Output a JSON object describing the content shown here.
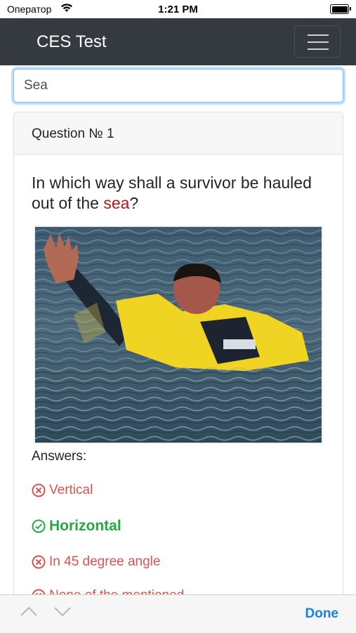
{
  "status_bar": {
    "carrier": "Оператор",
    "time": "1:21 PM"
  },
  "navbar": {
    "brand": "CES Test"
  },
  "search": {
    "value": "Sea"
  },
  "card": {
    "header": "Question № 1",
    "question_before": "In which way shall a survivor be hauled out of the ",
    "question_highlight": "sea",
    "question_after": "?",
    "answers_title": "Answers:",
    "answers": [
      {
        "label": "Vertical",
        "correct": false
      },
      {
        "label": "Horizontal",
        "correct": true
      },
      {
        "label": "In 45 degree angle",
        "correct": false
      },
      {
        "label": "None of the mentioned",
        "correct": false
      }
    ]
  },
  "accessory": {
    "done_label": "Done"
  },
  "colors": {
    "navbar": "#343a40",
    "highlight": "#b0171d",
    "wrong": "#d9534f",
    "correct": "#28a745",
    "done": "#1a7fe0"
  }
}
